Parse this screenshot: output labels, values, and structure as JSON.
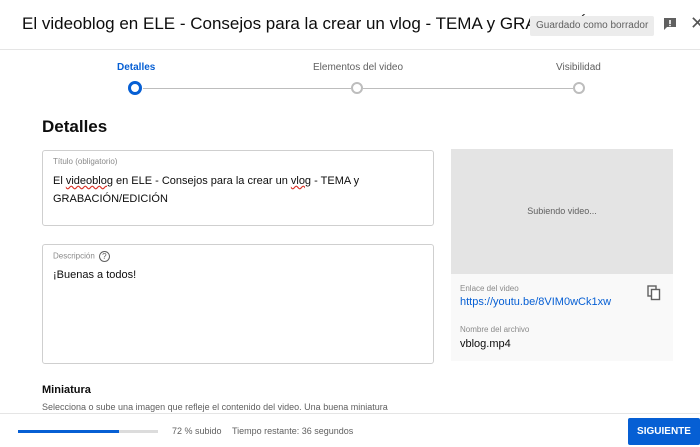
{
  "header": {
    "title": "El videoblog en ELE - Consejos para la crear un vlog - TEMA y GRABACIÓ...",
    "draft_badge": "Guardado como borrador",
    "feedback_icon": "feedback-icon",
    "close_icon": "close-icon"
  },
  "stepper": {
    "steps": [
      {
        "label": "Detalles",
        "active": true
      },
      {
        "label": "Elementos del video",
        "active": false
      },
      {
        "label": "Visibilidad",
        "active": false
      }
    ]
  },
  "details": {
    "section_title": "Detalles",
    "title_field": {
      "label": "Título (obligatorio)",
      "value_parts": [
        "El ",
        "videoblog",
        " en ELE - Consejos para la crear un ",
        "vlog",
        " - TEMA y"
      ],
      "value_line2": "GRABACIÓN/EDICIÓN"
    },
    "description_field": {
      "label": "Descripción",
      "help_icon": "help-icon",
      "value": "¡Buenas a todos!"
    }
  },
  "preview": {
    "uploading_text": "Subiendo video...",
    "link_label": "Enlace del video",
    "link_value": "https://youtu.be/8VIM0wCk1xw",
    "copy_icon": "copy-icon",
    "file_label": "Nombre del archivo",
    "file_value": "vblog.mp4"
  },
  "thumbnail": {
    "title": "Miniatura",
    "description": "Selecciona o sube una imagen que refleje el contenido del video. Una buena miniatura"
  },
  "footer": {
    "progress_percent": 72,
    "progress_text": "72 % subido",
    "remaining_text": "Tiempo restante: 36 segundos",
    "next_label": "SIGUIENTE"
  },
  "colors": {
    "accent": "#065fd4",
    "step_inactive": "#bdbdbd",
    "spellcheck": "#d93025"
  }
}
